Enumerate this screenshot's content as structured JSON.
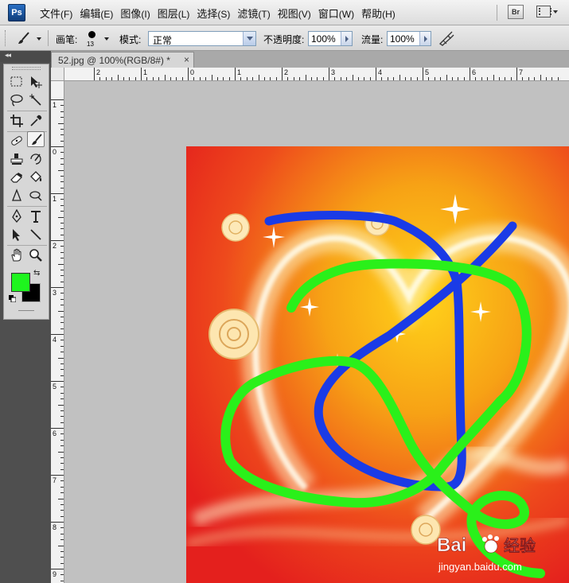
{
  "app": {
    "logo_text": "Ps"
  },
  "menu": {
    "items": [
      {
        "label": "文件",
        "key": "(F)"
      },
      {
        "label": "编辑",
        "key": "(E)"
      },
      {
        "label": "图像",
        "key": "(I)"
      },
      {
        "label": "图层",
        "key": "(L)"
      },
      {
        "label": "选择",
        "key": "(S)"
      },
      {
        "label": "滤镜",
        "key": "(T)"
      },
      {
        "label": "视图",
        "key": "(V)"
      },
      {
        "label": "窗口",
        "key": "(W)"
      },
      {
        "label": "帮助",
        "key": "(H)"
      }
    ],
    "bridge_label": "Br"
  },
  "options": {
    "brush_label": "画笔:",
    "brush_size": "13",
    "mode_label": "模式:",
    "mode_value": "正常",
    "opacity_label": "不透明度:",
    "opacity_value": "100%",
    "flow_label": "流量:",
    "flow_value": "100%"
  },
  "document": {
    "tab_title": "52.jpg @ 100%(RGB/8#) *",
    "close_glyph": "×"
  },
  "colors": {
    "foreground": "#1ef51e",
    "background": "#000000",
    "stroke_blue": "#1a3be6",
    "stroke_green": "#2af01a"
  },
  "toolbox": {
    "collapse_glyph": "◂◂",
    "tools": [
      "rectangular-marquee",
      "move",
      "lasso",
      "magic-wand",
      "crop",
      "eyedropper",
      "healing-brush",
      "brush",
      "clone-stamp",
      "history-brush",
      "eraser",
      "paint-bucket",
      "blur",
      "dodge",
      "pen",
      "type",
      "path-selection",
      "line",
      "hand",
      "zoom"
    ],
    "active_tool": "brush"
  },
  "rulers": {
    "horizontal_labels": [
      "2",
      "1",
      "0",
      "1",
      "2",
      "3",
      "4",
      "5",
      "6",
      "7"
    ],
    "vertical_labels": [
      "1",
      "0",
      "1",
      "2",
      "3",
      "4",
      "5",
      "6",
      "7",
      "8",
      "9"
    ]
  },
  "watermark": {
    "brand_text": "Bai",
    "brand_suffix": "经验",
    "url": "jingyan.baidu.com"
  }
}
